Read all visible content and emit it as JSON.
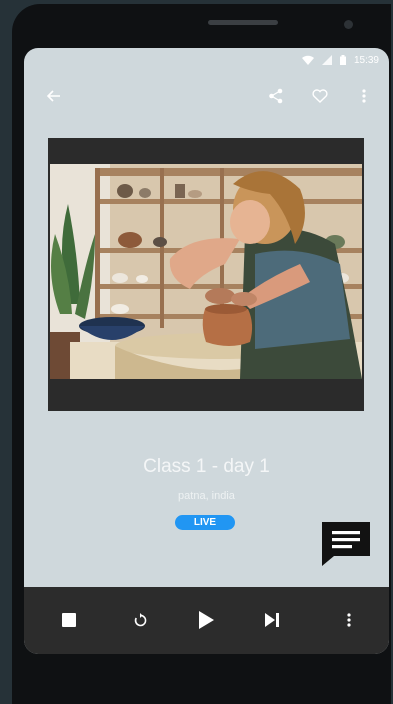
{
  "status_bar": {
    "time": "15:39",
    "icons": [
      "wifi-icon",
      "signal-icon",
      "battery-icon"
    ]
  },
  "app_bar": {
    "back_icon": "arrow-left-icon",
    "share_icon": "share-icon",
    "favorite_icon": "heart-outline-icon",
    "menu_icon": "more-vertical-icon"
  },
  "video": {
    "thumbnail": "pottery-class-photo"
  },
  "class_info": {
    "title": "Class 1 - day 1",
    "location": "patna, india",
    "badge": "LIVE"
  },
  "chat_button": {
    "icon": "chat-message-icon"
  },
  "controls": {
    "items": [
      "stop-icon",
      "replay-icon",
      "play-icon",
      "skip-next-icon",
      "more-vertical-icon"
    ]
  },
  "colors": {
    "screen_bg": "#cfd8dc",
    "accent": "#2196f3",
    "controls_bg": "#2c2c2c",
    "device_bg": "#0f1113",
    "page_bg": "#263238"
  }
}
